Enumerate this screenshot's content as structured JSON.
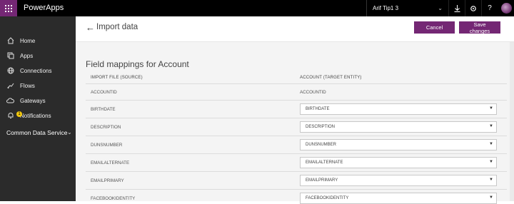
{
  "app": {
    "title": "PowerApps"
  },
  "environment": {
    "label": "Arif Tip1 3"
  },
  "icons": {
    "waffle": "waffle-icon",
    "download": "download-icon",
    "settings": "gear-icon",
    "help": "help-icon",
    "back": "back-arrow-icon",
    "chevron": "chevron-down-icon"
  },
  "colors": {
    "brand": "#742774",
    "topbar": "#000000",
    "sidebar": "#2b2b2b",
    "content_bg": "#f4f4f4"
  },
  "sidebar": {
    "items": [
      {
        "label": "Home",
        "icon": "home-icon"
      },
      {
        "label": "Apps",
        "icon": "apps-icon"
      },
      {
        "label": "Connections",
        "icon": "globe-icon"
      },
      {
        "label": "Flows",
        "icon": "flow-icon"
      },
      {
        "label": "Gateways",
        "icon": "cloud-icon"
      },
      {
        "label": "Notifications",
        "icon": "bell-icon",
        "badge": "1"
      }
    ],
    "section": "Common Data Service"
  },
  "header": {
    "title": "Import data",
    "cancel_label": "Cancel",
    "save_label": "Save changes"
  },
  "mappings": {
    "title": "Field mappings for Account",
    "source_header": "IMPORT FILE (SOURCE)",
    "target_header": "ACCOUNT (TARGET ENTITY)",
    "rows": [
      {
        "source": "ACCOUNTID",
        "target": "ACCOUNTID"
      },
      {
        "source": "BIRTHDATE",
        "target": "BIRTHDATE"
      },
      {
        "source": "DESCRIPTION",
        "target": "DESCRIPTION"
      },
      {
        "source": "DUNSNUMBER",
        "target": "DUNSNUMBER"
      },
      {
        "source": "EMAILALTERNATE",
        "target": "EMAILALTERNATE"
      },
      {
        "source": "EMAILPRIMARY",
        "target": "EMAILPRIMARY"
      },
      {
        "source": "FACEBOOKIDENTITY",
        "target": "FACEBOOKIDENTITY"
      }
    ]
  }
}
